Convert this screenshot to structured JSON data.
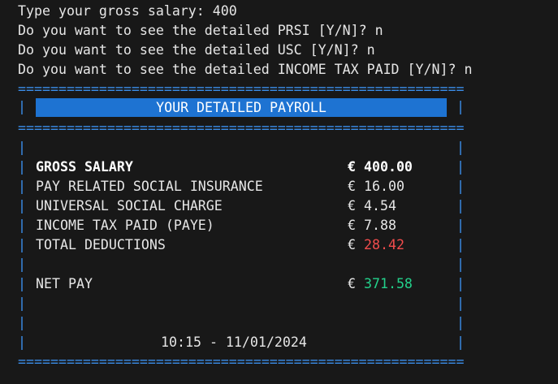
{
  "prompts": [
    {
      "text": "Type your gross salary: 400"
    },
    {
      "text": "Do you want to see the detailed PRSI [Y/N]? n"
    },
    {
      "text": "Do you want to see the detailed USC [Y/N]? n"
    },
    {
      "text": "Do you want to see the detailed INCOME TAX PAID [Y/N]? n"
    }
  ],
  "rule": "==================================================================",
  "bar": "|",
  "title": "YOUR DETAILED PAYROLL",
  "rows": [
    {
      "label": "GROSS SALARY",
      "value": "€ 400.00"
    },
    {
      "label": "PAY RELATED SOCIAL INSURANCE",
      "value": "€ 16.00"
    },
    {
      "label": "UNIVERSAL SOCIAL CHARGE",
      "value": "€ 4.54"
    },
    {
      "label": "INCOME TAX PAID (PAYE)",
      "value": "€ 7.88"
    },
    {
      "label": "TOTAL DEDUCTIONS",
      "value_prefix": "€ ",
      "value_amount": "28.42"
    }
  ],
  "net_pay": {
    "label": "NET PAY",
    "value_prefix": "€ ",
    "value_amount": "371.58"
  },
  "footer": {
    "datetime": "10:15 - 11/01/2024"
  },
  "colors": {
    "frame": "#3b8eea",
    "title_background": "#1e73d2",
    "deductions": "#f14c4c",
    "net_pay": "#23d18b"
  }
}
